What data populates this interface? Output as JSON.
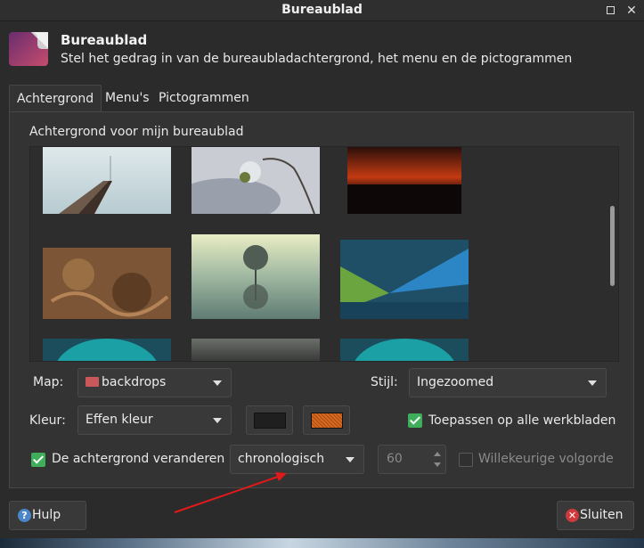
{
  "window": {
    "title": "Bureaublad"
  },
  "header": {
    "title": "Bureaublad",
    "subtitle": "Stel het gedrag in van de bureaubladachtergrond, het menu en de pictogrammen"
  },
  "tabs": [
    {
      "label": "Achtergrond",
      "active": true
    },
    {
      "label": "Menu's",
      "active": false
    },
    {
      "label": "Pictogrammen",
      "active": false
    }
  ],
  "background_tab": {
    "section_label": "Achtergrond voor mijn bureaublad",
    "folder": {
      "label": "Map:",
      "value": "backdrops",
      "icon": "folder-icon"
    },
    "style": {
      "label": "Stijl:",
      "value": "Ingezoomed"
    },
    "color": {
      "label": "Kleur:",
      "value": "Effen kleur",
      "primary": "#1f1f1f",
      "secondary": "#d9681f"
    },
    "apply_all": {
      "label": "Toepassen op alle werkbladen",
      "checked": true
    },
    "change_background": {
      "label": "De achtergrond veranderen",
      "checked": true
    },
    "interval_mode": {
      "value": "chronologisch"
    },
    "interval": {
      "value": "60"
    },
    "random_order": {
      "label": "Willekeurige volgorde",
      "checked": false
    }
  },
  "footer": {
    "help_label": "Hulp",
    "close_label": "Sluiten"
  },
  "colors": {
    "check_green": "#3fae5a",
    "close_red": "#d0393c",
    "help_blue": "#4a86c8",
    "annotation_red": "#e01a1a"
  }
}
